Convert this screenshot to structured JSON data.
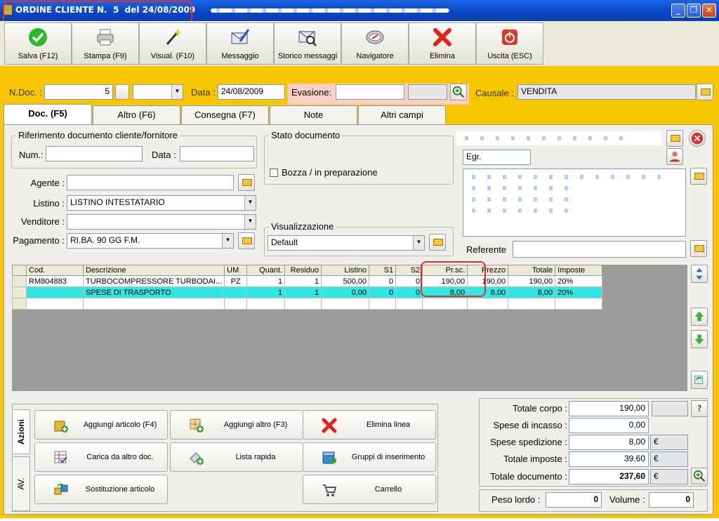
{
  "window": {
    "title": "ORDINE CLIENTE N.  5  del 24/08/2009",
    "minimize": "_",
    "restore": "❐",
    "close": "✕"
  },
  "toolbar": [
    {
      "label": "Salva (F12)",
      "icon": "check-icon"
    },
    {
      "label": "Stampa (F9)",
      "icon": "printer-icon"
    },
    {
      "label": "Visual. (F10)",
      "icon": "magic-wand-icon"
    },
    {
      "label": "Messaggio",
      "icon": "envelope-pen-icon"
    },
    {
      "label": "Storico messaggi",
      "icon": "envelope-search-icon"
    },
    {
      "label": "Navigatore",
      "icon": "compass-icon"
    },
    {
      "label": "Elimina",
      "icon": "red-x-icon"
    },
    {
      "label": "Uscita (ESC)",
      "icon": "power-icon"
    }
  ],
  "header": {
    "ndoc_label": "N.Doc. :",
    "ndoc_value": "5",
    "data_label": "Data :",
    "data_value": "24/08/2009",
    "evasione_label": "Evasione:",
    "evasione_value": "",
    "causale_label": "Causale :",
    "causale_value": "VENDITA"
  },
  "tabs": [
    "Doc. (F5)",
    "Altro (F6)",
    "Consegna (F7)",
    "Note",
    "Altri campi"
  ],
  "riferimento": {
    "title": "Riferimento documento cliente/fornitore",
    "num_label": "Num.:",
    "data_label": "Data :"
  },
  "stato": {
    "title": "Stato documento",
    "bozza_label": "Bozza / in preparazione"
  },
  "fields": {
    "agente_label": "Agente :",
    "agente_value": "",
    "listino_label": "Listino :",
    "listino_value": "LISTINO INTESTATARIO",
    "venditore_label": "Venditore :",
    "venditore_value": "",
    "pagamento_label": "Pagamento :",
    "pagamento_value": "RI.BA. 90 GG F.M."
  },
  "visualizzazione": {
    "title": "Visualizzazione",
    "value": "Default"
  },
  "cliente": {
    "title_value": "Egr.",
    "referente_label": "Referente",
    "referente_value": ""
  },
  "grid": {
    "columns": [
      "Cod.",
      "Descrizione",
      "UM",
      "Quant.",
      "Residuo",
      "Listino",
      "S1",
      "S2",
      "Pr.sc.",
      "Prezzo",
      "Totale",
      "Imposte"
    ],
    "rows": [
      [
        "RM804883",
        "TURBOCOMPRESSORE TURBODAI...",
        "PZ",
        "1",
        "1",
        "500,00",
        "0",
        "0",
        "190,00",
        "190,00",
        "190,00",
        "20%"
      ],
      [
        "",
        "SPESE DI TRASPORTO",
        "",
        "1",
        "1",
        "0,00",
        "0",
        "0",
        "8,00",
        "8,00",
        "8,00",
        "20%"
      ],
      [
        "",
        "",
        "",
        "",
        "",
        "",
        "",
        "",
        "",
        "",
        "",
        ""
      ]
    ]
  },
  "actions": {
    "vtab1": "Azioni",
    "vtab2": "AV.",
    "buttons": [
      {
        "label": "Aggiungi articolo (F4)",
        "icon": "add-box-icon"
      },
      {
        "label": "Aggiungi altro (F3)",
        "icon": "add-grid-icon"
      },
      {
        "label": "Elimina linea",
        "icon": "red-x-icon"
      },
      {
        "label": "Carica da altro doc.",
        "icon": "load-doc-icon"
      },
      {
        "label": "Lista rapida",
        "icon": "quick-list-icon"
      },
      {
        "label": "Gruppi di inserimento",
        "icon": "group-insert-icon"
      },
      {
        "label": "Sostituzione articolo",
        "icon": "replace-item-icon"
      },
      {
        "label": "Carrello",
        "icon": "cart-icon"
      }
    ]
  },
  "totals": {
    "corpo_label": "Totale corpo :",
    "corpo_value": "190,00",
    "question": "?",
    "incasso_label": "Spese di incasso :",
    "incasso_value": "0,00",
    "spedizione_label": "Spese spedizione :",
    "spedizione_value": "8,00",
    "imposte_label": "Totale imposte :",
    "imposte_value": "39,60",
    "documento_label": "Totale documento :",
    "documento_value": "237,60",
    "currency": "€",
    "peso_label": "Peso lordo :",
    "peso_value": "0",
    "volume_label": "Volume :",
    "volume_value": "0"
  }
}
